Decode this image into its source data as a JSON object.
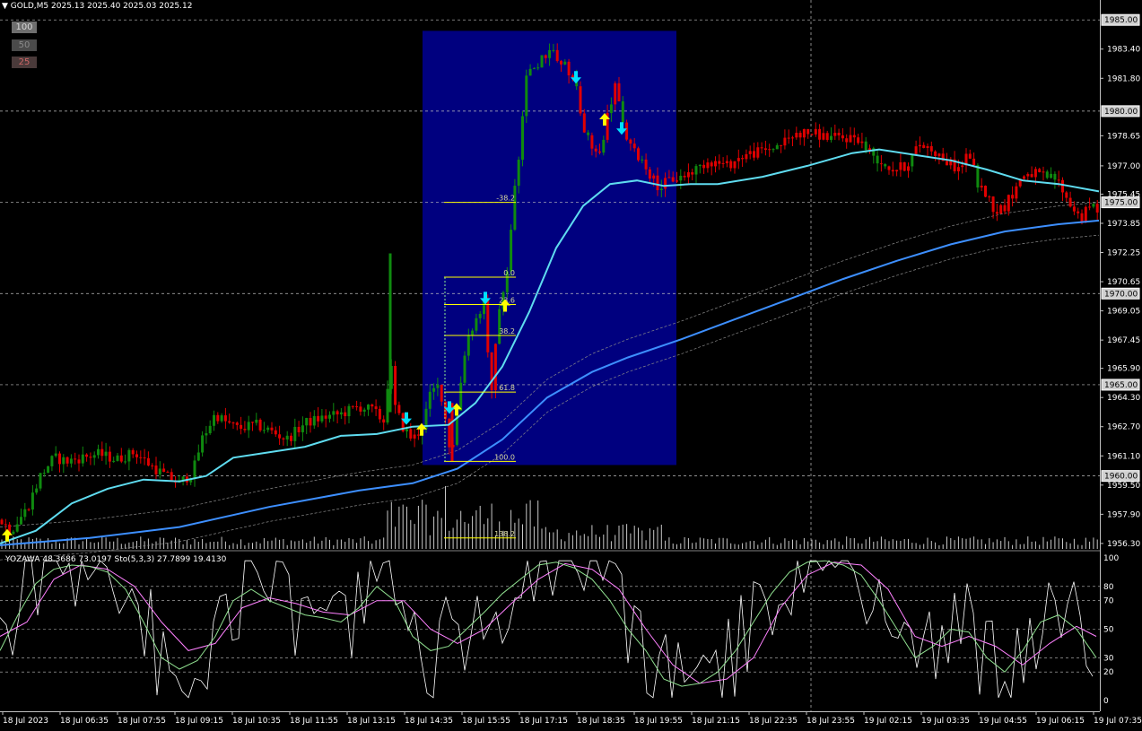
{
  "header": {
    "symbol_text": "GOLD,M5  2025.13 2025.40 2025.03 2025.12",
    "menu_icon": "triangle-down-icon"
  },
  "zoom_buttons": [
    "100",
    "50",
    "25"
  ],
  "subwindow": {
    "label": "YOZAWA 48.3686 73.0197  Sto(5,3,3) 27.7899 19.4130"
  },
  "colors": {
    "background": "#000000",
    "bull_bar": "#0f8a0f",
    "bear_bar": "#e00000",
    "highlight_box": "#00007f",
    "fib_lines": "#ffff00",
    "ma_fast": "#5fdcf0",
    "ma_slow": "#3d8fff",
    "band": "#8a8a8a",
    "volume": "#c8c8c8",
    "arrow_up": "#ffff00",
    "arrow_down": "#00e0ff",
    "stoch_main": "#90e090",
    "stoch_signal": "#ff80ff",
    "yozawa": "#ffffff",
    "grid": "#c0c0c0"
  },
  "chart_data": [
    {
      "type": "candlestick",
      "symbol": "GOLD",
      "timeframe": "M5",
      "y_ticks": [
        "1983.40",
        "1981.80",
        "1978.65",
        "1977.00",
        "1975.45",
        "1973.85",
        "1972.25",
        "1970.65",
        "1969.05",
        "1967.45",
        "1965.90",
        "1964.30",
        "1962.70",
        "1961.10",
        "1959.50",
        "1957.90",
        "1956.30"
      ],
      "y_tick_values": [
        1983.4,
        1981.8,
        1978.65,
        1977.0,
        1975.45,
        1973.85,
        1972.25,
        1970.65,
        1969.05,
        1967.45,
        1965.9,
        1964.3,
        1962.7,
        1961.1,
        1959.5,
        1957.9,
        1956.3
      ],
      "y_boxed": [
        "1985.00",
        "1980.00",
        "1975.00",
        "1970.00",
        "1965.00",
        "1960.00"
      ],
      "y_boxed_values": [
        1985,
        1980,
        1975,
        1970,
        1965,
        1960
      ],
      "ylim": [
        1956.0,
        1985.6
      ],
      "x_ticks": [
        "18 Jul 2023",
        "18 Jul 06:35",
        "18 Jul 07:55",
        "18 Jul 09:15",
        "18 Jul 10:35",
        "18 Jul 11:55",
        "18 Jul 13:15",
        "18 Jul 14:35",
        "18 Jul 15:55",
        "18 Jul 17:15",
        "18 Jul 18:35",
        "18 Jul 19:55",
        "18 Jul 21:15",
        "18 Jul 22:35",
        "18 Jul 23:55",
        "19 Jul 02:15",
        "19 Jul 03:35",
        "19 Jul 04:55",
        "19 Jul 06:15",
        "19 Jul 07:35"
      ],
      "price_path": [
        [
          0,
          1957.6
        ],
        [
          12,
          1957.0
        ],
        [
          30,
          1958.2
        ],
        [
          45,
          1960.0
        ],
        [
          60,
          1961.0
        ],
        [
          75,
          1960.8
        ],
        [
          90,
          1961.0
        ],
        [
          110,
          1961.2
        ],
        [
          130,
          1960.9
        ],
        [
          150,
          1961.3
        ],
        [
          170,
          1960.5
        ],
        [
          185,
          1960.0
        ],
        [
          200,
          1959.6
        ],
        [
          215,
          1960.2
        ],
        [
          225,
          1962.0
        ],
        [
          240,
          1963.4
        ],
        [
          250,
          1963.0
        ],
        [
          265,
          1962.6
        ],
        [
          285,
          1962.8
        ],
        [
          300,
          1962.5
        ],
        [
          320,
          1962.0
        ],
        [
          340,
          1962.9
        ],
        [
          360,
          1963.2
        ],
        [
          380,
          1963.4
        ],
        [
          400,
          1963.8
        ],
        [
          415,
          1963.6
        ],
        [
          428,
          1963.0
        ],
        [
          435,
          1966.5
        ],
        [
          440,
          1963.8
        ],
        [
          450,
          1962.6
        ],
        [
          460,
          1962.0
        ],
        [
          470,
          1962.6
        ],
        [
          480,
          1964.5
        ],
        [
          490,
          1965.0
        ],
        [
          497,
          1963.0
        ],
        [
          503,
          1961.0
        ],
        [
          510,
          1963.8
        ],
        [
          520,
          1967.5
        ],
        [
          530,
          1968.5
        ],
        [
          540,
          1969.5
        ],
        [
          547,
          1964.0
        ],
        [
          555,
          1969.0
        ],
        [
          563,
          1970.2
        ],
        [
          570,
          1974.0
        ],
        [
          578,
          1977.5
        ],
        [
          586,
          1981.8
        ],
        [
          595,
          1982.3
        ],
        [
          605,
          1983.0
        ],
        [
          615,
          1983.5
        ],
        [
          625,
          1982.7
        ],
        [
          635,
          1982.2
        ],
        [
          642,
          1981.5
        ],
        [
          650,
          1979.0
        ],
        [
          660,
          1978.0
        ],
        [
          668,
          1977.5
        ],
        [
          676,
          1979.5
        ],
        [
          686,
          1981.5
        ],
        [
          695,
          1979.0
        ],
        [
          705,
          1977.8
        ],
        [
          715,
          1977.4
        ],
        [
          725,
          1976.5
        ],
        [
          735,
          1975.8
        ],
        [
          745,
          1976.2
        ],
        [
          760,
          1976.4
        ],
        [
          775,
          1976.8
        ],
        [
          790,
          1977.3
        ],
        [
          810,
          1977.0
        ],
        [
          830,
          1977.6
        ],
        [
          850,
          1977.8
        ],
        [
          870,
          1978.2
        ],
        [
          890,
          1978.8
        ],
        [
          905,
          1978.8
        ],
        [
          920,
          1978.6
        ],
        [
          940,
          1978.5
        ],
        [
          955,
          1978.6
        ],
        [
          965,
          1978.0
        ],
        [
          980,
          1977.3
        ],
        [
          995,
          1976.8
        ],
        [
          1010,
          1977.0
        ],
        [
          1025,
          1978.2
        ],
        [
          1040,
          1977.9
        ],
        [
          1055,
          1977.2
        ],
        [
          1070,
          1976.8
        ],
        [
          1080,
          1977.8
        ],
        [
          1090,
          1976.0
        ],
        [
          1100,
          1975.4
        ],
        [
          1110,
          1974.5
        ],
        [
          1120,
          1974.8
        ],
        [
          1130,
          1975.6
        ],
        [
          1140,
          1976.5
        ],
        [
          1150,
          1976.6
        ],
        [
          1165,
          1976.4
        ],
        [
          1178,
          1976.3
        ],
        [
          1190,
          1975.1
        ],
        [
          1205,
          1974.1
        ],
        [
          1215,
          1974.8
        ],
        [
          1225,
          1974.6
        ]
      ],
      "ma_fast_values": [
        [
          0,
          1956.3
        ],
        [
          40,
          1957.0
        ],
        [
          80,
          1958.5
        ],
        [
          120,
          1959.3
        ],
        [
          160,
          1959.8
        ],
        [
          200,
          1959.7
        ],
        [
          230,
          1960.0
        ],
        [
          260,
          1961.0
        ],
        [
          300,
          1961.3
        ],
        [
          340,
          1961.6
        ],
        [
          380,
          1962.2
        ],
        [
          420,
          1962.3
        ],
        [
          460,
          1962.7
        ],
        [
          500,
          1962.8
        ],
        [
          530,
          1964.0
        ],
        [
          560,
          1966.0
        ],
        [
          590,
          1969.0
        ],
        [
          620,
          1972.5
        ],
        [
          650,
          1974.8
        ],
        [
          680,
          1976.0
        ],
        [
          710,
          1976.2
        ],
        [
          740,
          1975.9
        ],
        [
          770,
          1976.0
        ],
        [
          800,
          1976.0
        ],
        [
          850,
          1976.4
        ],
        [
          900,
          1977.0
        ],
        [
          950,
          1977.7
        ],
        [
          980,
          1977.9
        ],
        [
          1020,
          1977.6
        ],
        [
          1060,
          1977.3
        ],
        [
          1100,
          1976.8
        ],
        [
          1140,
          1976.2
        ],
        [
          1180,
          1976.0
        ],
        [
          1225,
          1975.6
        ]
      ],
      "ma_slow_values": [
        [
          0,
          1956.2
        ],
        [
          100,
          1956.6
        ],
        [
          200,
          1957.2
        ],
        [
          300,
          1958.3
        ],
        [
          400,
          1959.2
        ],
        [
          460,
          1959.6
        ],
        [
          510,
          1960.4
        ],
        [
          560,
          1962.0
        ],
        [
          610,
          1964.3
        ],
        [
          660,
          1965.7
        ],
        [
          700,
          1966.5
        ],
        [
          760,
          1967.5
        ],
        [
          820,
          1968.6
        ],
        [
          880,
          1969.7
        ],
        [
          940,
          1970.8
        ],
        [
          1000,
          1971.8
        ],
        [
          1060,
          1972.7
        ],
        [
          1120,
          1973.4
        ],
        [
          1180,
          1973.8
        ],
        [
          1225,
          1974.0
        ]
      ],
      "fib_levels": [
        "-38.2",
        "0.0",
        "23.6",
        "38.2",
        "61.8",
        "100.0",
        "138.2"
      ],
      "fib_values": [
        1975.0,
        1970.9,
        1969.4,
        1967.7,
        1964.6,
        1960.8,
        1956.6
      ],
      "highlight_range": {
        "x_from": "18 Jul 14:35",
        "x_to": "18 Jul 19:55",
        "y_from": 1960.6,
        "y_to": 1984.4
      },
      "arrows_up": [
        [
          8,
          1956.7
        ],
        [
          470,
          1962.5
        ],
        [
          509,
          1963.6
        ],
        [
          674,
          1979.5
        ],
        [
          563,
          1969.3
        ]
      ],
      "arrows_down": [
        [
          453,
          1963.2
        ],
        [
          501,
          1963.8
        ],
        [
          541,
          1969.8
        ],
        [
          642,
          1981.9
        ],
        [
          693,
          1979.1
        ]
      ]
    },
    {
      "type": "line",
      "name": "subwindow",
      "series": [
        {
          "name": "YOZAWA",
          "last": 48.3686
        },
        {
          "name": "Sto(5,3,3)",
          "main_last": 27.7899,
          "signal_last": 19.413
        }
      ],
      "y_ticks": [
        "100",
        "80",
        "70",
        "50",
        "30",
        "20",
        "0"
      ],
      "y_tick_values": [
        100,
        80,
        70,
        50,
        30,
        20,
        0
      ],
      "ylim": [
        0,
        100
      ],
      "stoch_main": [
        [
          0,
          35
        ],
        [
          20,
          60
        ],
        [
          40,
          82
        ],
        [
          60,
          92
        ],
        [
          80,
          95
        ],
        [
          100,
          94
        ],
        [
          120,
          90
        ],
        [
          140,
          78
        ],
        [
          160,
          55
        ],
        [
          180,
          30
        ],
        [
          200,
          22
        ],
        [
          220,
          28
        ],
        [
          240,
          45
        ],
        [
          260,
          70
        ],
        [
          280,
          78
        ],
        [
          300,
          70
        ],
        [
          320,
          65
        ],
        [
          340,
          60
        ],
        [
          360,
          58
        ],
        [
          380,
          55
        ],
        [
          400,
          65
        ],
        [
          420,
          80
        ],
        [
          440,
          70
        ],
        [
          460,
          45
        ],
        [
          480,
          35
        ],
        [
          500,
          38
        ],
        [
          520,
          50
        ],
        [
          540,
          62
        ],
        [
          560,
          75
        ],
        [
          580,
          85
        ],
        [
          600,
          95
        ],
        [
          620,
          97
        ],
        [
          640,
          93
        ],
        [
          660,
          85
        ],
        [
          680,
          70
        ],
        [
          700,
          50
        ],
        [
          720,
          35
        ],
        [
          740,
          15
        ],
        [
          760,
          10
        ],
        [
          780,
          12
        ],
        [
          800,
          20
        ],
        [
          820,
          35
        ],
        [
          840,
          55
        ],
        [
          860,
          75
        ],
        [
          880,
          90
        ],
        [
          900,
          97
        ],
        [
          920,
          98
        ],
        [
          940,
          95
        ],
        [
          960,
          88
        ],
        [
          980,
          70
        ],
        [
          1000,
          50
        ],
        [
          1020,
          30
        ],
        [
          1040,
          38
        ],
        [
          1060,
          50
        ],
        [
          1080,
          48
        ],
        [
          1100,
          30
        ],
        [
          1120,
          20
        ],
        [
          1140,
          35
        ],
        [
          1160,
          55
        ],
        [
          1180,
          60
        ],
        [
          1200,
          50
        ],
        [
          1222,
          30
        ]
      ],
      "stoch_signal": [
        [
          0,
          45
        ],
        [
          30,
          55
        ],
        [
          60,
          85
        ],
        [
          90,
          95
        ],
        [
          120,
          92
        ],
        [
          150,
          80
        ],
        [
          180,
          55
        ],
        [
          210,
          35
        ],
        [
          240,
          40
        ],
        [
          270,
          65
        ],
        [
          300,
          72
        ],
        [
          330,
          68
        ],
        [
          360,
          62
        ],
        [
          390,
          60
        ],
        [
          420,
          70
        ],
        [
          450,
          70
        ],
        [
          480,
          50
        ],
        [
          510,
          40
        ],
        [
          540,
          50
        ],
        [
          570,
          68
        ],
        [
          600,
          85
        ],
        [
          630,
          96
        ],
        [
          660,
          92
        ],
        [
          690,
          78
        ],
        [
          720,
          50
        ],
        [
          750,
          25
        ],
        [
          780,
          12
        ],
        [
          810,
          15
        ],
        [
          840,
          30
        ],
        [
          870,
          65
        ],
        [
          900,
          88
        ],
        [
          930,
          97
        ],
        [
          960,
          95
        ],
        [
          990,
          78
        ],
        [
          1020,
          45
        ],
        [
          1050,
          38
        ],
        [
          1080,
          45
        ],
        [
          1110,
          38
        ],
        [
          1140,
          25
        ],
        [
          1170,
          40
        ],
        [
          1200,
          52
        ],
        [
          1222,
          45
        ]
      ],
      "yozawa_seed": 7
    }
  ]
}
